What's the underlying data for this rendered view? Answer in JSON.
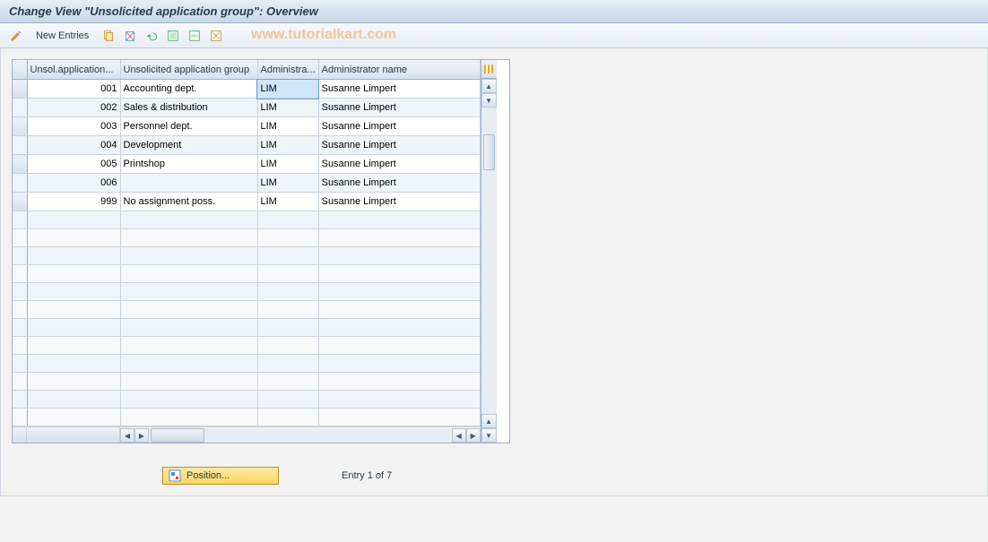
{
  "title": "Change View \"Unsolicited application group\": Overview",
  "toolbar": {
    "new_entries": "New Entries"
  },
  "watermark": "www.tutorialkart.com",
  "columns": {
    "rowsel": "",
    "c1": "Unsol.application...",
    "c2": "Unsolicited application group",
    "c3": "Administra...",
    "c4": "Administrator name"
  },
  "rows": [
    {
      "code": "001",
      "group": "Accounting dept.",
      "admin": "LIM",
      "name": "Susanne Limpert"
    },
    {
      "code": "002",
      "group": "Sales & distribution",
      "admin": "LIM",
      "name": "Susanne Limpert"
    },
    {
      "code": "003",
      "group": "Personnel dept.",
      "admin": "LIM",
      "name": "Susanne Limpert"
    },
    {
      "code": "004",
      "group": "Development",
      "admin": "LIM",
      "name": "Susanne Limpert"
    },
    {
      "code": "005",
      "group": "Printshop",
      "admin": "LIM",
      "name": "Susanne Limpert"
    },
    {
      "code": "006",
      "group": "",
      "admin": "LIM",
      "name": "Susanne Limpert"
    },
    {
      "code": "999",
      "group": "No assignment poss.",
      "admin": "LIM",
      "name": "Susanne Limpert"
    }
  ],
  "empty_rows": 12,
  "position_button": "Position...",
  "entry_status": "Entry 1 of 7",
  "selected": {
    "row": 0,
    "col": "admin"
  }
}
